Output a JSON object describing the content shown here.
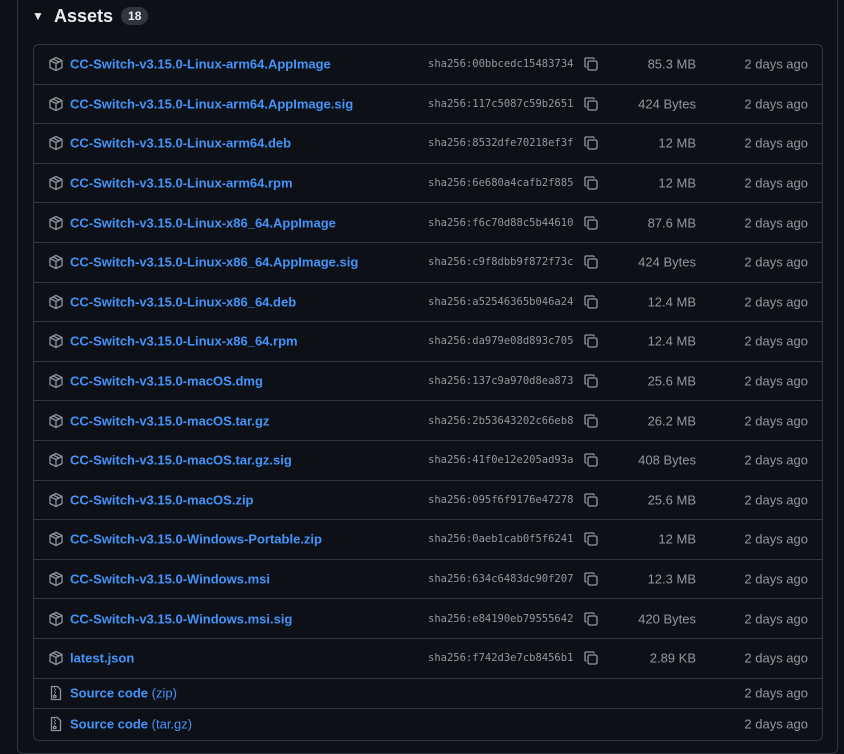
{
  "assets": {
    "title": "Assets",
    "count": "18",
    "items": [
      {
        "name": "CC-Switch-v3.15.0-Linux-arm64.AppImage",
        "sha": "sha256:00bbcedc15483734",
        "size": "85.3 MB",
        "date": "2 days ago"
      },
      {
        "name": "CC-Switch-v3.15.0-Linux-arm64.AppImage.sig",
        "sha": "sha256:117c5087c59b2651",
        "size": "424 Bytes",
        "date": "2 days ago"
      },
      {
        "name": "CC-Switch-v3.15.0-Linux-arm64.deb",
        "sha": "sha256:8532dfe70218ef3f",
        "size": "12 MB",
        "date": "2 days ago"
      },
      {
        "name": "CC-Switch-v3.15.0-Linux-arm64.rpm",
        "sha": "sha256:6e680a4cafb2f885",
        "size": "12 MB",
        "date": "2 days ago"
      },
      {
        "name": "CC-Switch-v3.15.0-Linux-x86_64.AppImage",
        "sha": "sha256:f6c70d88c5b44610",
        "size": "87.6 MB",
        "date": "2 days ago"
      },
      {
        "name": "CC-Switch-v3.15.0-Linux-x86_64.AppImage.sig",
        "sha": "sha256:c9f8dbb9f872f73c",
        "size": "424 Bytes",
        "date": "2 days ago"
      },
      {
        "name": "CC-Switch-v3.15.0-Linux-x86_64.deb",
        "sha": "sha256:a52546365b046a24",
        "size": "12.4 MB",
        "date": "2 days ago"
      },
      {
        "name": "CC-Switch-v3.15.0-Linux-x86_64.rpm",
        "sha": "sha256:da979e08d893c705",
        "size": "12.4 MB",
        "date": "2 days ago"
      },
      {
        "name": "CC-Switch-v3.15.0-macOS.dmg",
        "sha": "sha256:137c9a970d8ea873",
        "size": "25.6 MB",
        "date": "2 days ago"
      },
      {
        "name": "CC-Switch-v3.15.0-macOS.tar.gz",
        "sha": "sha256:2b53643202c66eb8",
        "size": "26.2 MB",
        "date": "2 days ago"
      },
      {
        "name": "CC-Switch-v3.15.0-macOS.tar.gz.sig",
        "sha": "sha256:41f0e12e205ad93a",
        "size": "408 Bytes",
        "date": "2 days ago"
      },
      {
        "name": "CC-Switch-v3.15.0-macOS.zip",
        "sha": "sha256:095f6f9176e47278",
        "size": "25.6 MB",
        "date": "2 days ago"
      },
      {
        "name": "CC-Switch-v3.15.0-Windows-Portable.zip",
        "sha": "sha256:0aeb1cab0f5f6241",
        "size": "12 MB",
        "date": "2 days ago"
      },
      {
        "name": "CC-Switch-v3.15.0-Windows.msi",
        "sha": "sha256:634c6483dc90f207",
        "size": "12.3 MB",
        "date": "2 days ago"
      },
      {
        "name": "CC-Switch-v3.15.0-Windows.msi.sig",
        "sha": "sha256:e84190eb79555642",
        "size": "420 Bytes",
        "date": "2 days ago"
      },
      {
        "name": "latest.json",
        "sha": "sha256:f742d3e7cb8456b1",
        "size": "2.89 KB",
        "date": "2 days ago"
      }
    ],
    "source": [
      {
        "label": "Source code",
        "sub": "(zip)",
        "date": "2 days ago"
      },
      {
        "label": "Source code",
        "sub": "(tar.gz)",
        "date": "2 days ago"
      }
    ]
  },
  "icons": {
    "package": "package-icon",
    "copy": "copy-icon",
    "file-zip": "file-zip-icon",
    "caret": "triangle-down-icon"
  },
  "colors": {
    "link": "#4493f8",
    "muted": "#9198a1",
    "border": "#30363d",
    "bg": "#0d1117"
  }
}
